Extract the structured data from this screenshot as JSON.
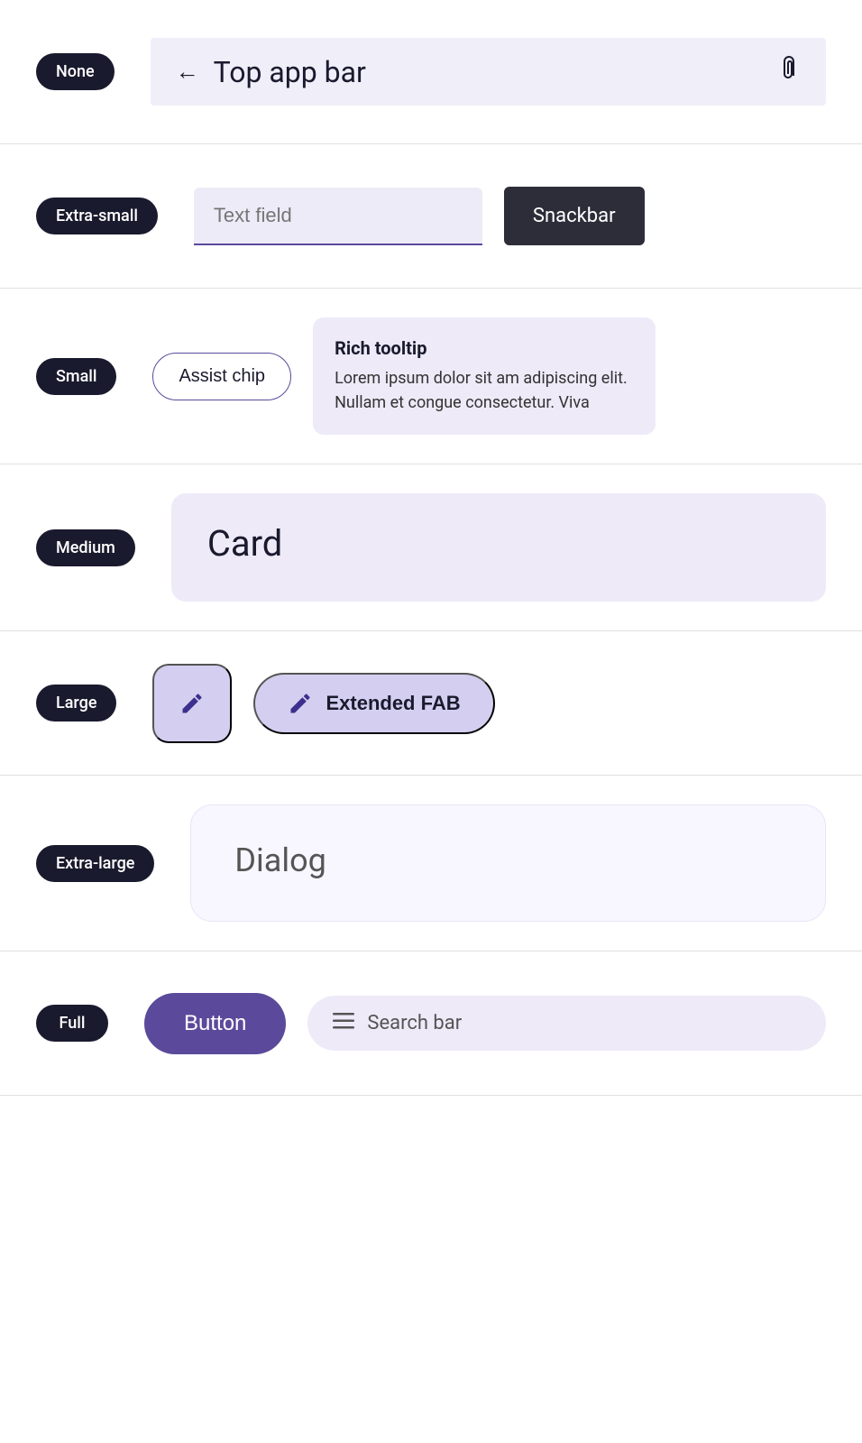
{
  "rows": [
    {
      "id": "none",
      "label": "None",
      "components": {
        "topAppBar": {
          "backLabel": "←",
          "title": "Top app bar",
          "iconLabel": "📎"
        }
      }
    },
    {
      "id": "extra-small",
      "label": "Extra-small",
      "components": {
        "textField": {
          "placeholder": "Text field"
        },
        "snackbar": {
          "label": "Snackbar"
        }
      }
    },
    {
      "id": "small",
      "label": "Small",
      "components": {
        "assistChip": {
          "label": "Assist chip"
        },
        "richTooltip": {
          "title": "Rich tooltip",
          "body": "Lorem ipsum dolor sit am adipiscing elit. Nullam et congue consectetur. Viva"
        }
      }
    },
    {
      "id": "medium",
      "label": "Medium",
      "components": {
        "card": {
          "title": "Card"
        }
      }
    },
    {
      "id": "large",
      "label": "Large",
      "components": {
        "fab": {
          "iconLabel": "pencil"
        },
        "extendedFab": {
          "iconLabel": "pencil",
          "label": "Extended FAB"
        }
      }
    },
    {
      "id": "extra-large",
      "label": "Extra-large",
      "components": {
        "dialog": {
          "title": "Dialog"
        }
      }
    },
    {
      "id": "full",
      "label": "Full",
      "components": {
        "button": {
          "label": "Button"
        },
        "searchBar": {
          "label": "Search bar"
        }
      }
    }
  ],
  "colors": {
    "pill_bg": "#1a1a2e",
    "pill_text": "#ffffff",
    "accent": "#5b4a9b",
    "fab_bg": "#d4cff0",
    "fab_icon": "#3d2f8e",
    "card_bg": "#eeeaf8",
    "tooltip_bg": "#eeeaf8",
    "search_bg": "#eeeaf8",
    "textfield_bg": "#eeebf8",
    "snackbar_bg": "#2d2d3a",
    "dialog_bg": "#f8f7ff",
    "topbar_bg": "#f0eef8"
  }
}
